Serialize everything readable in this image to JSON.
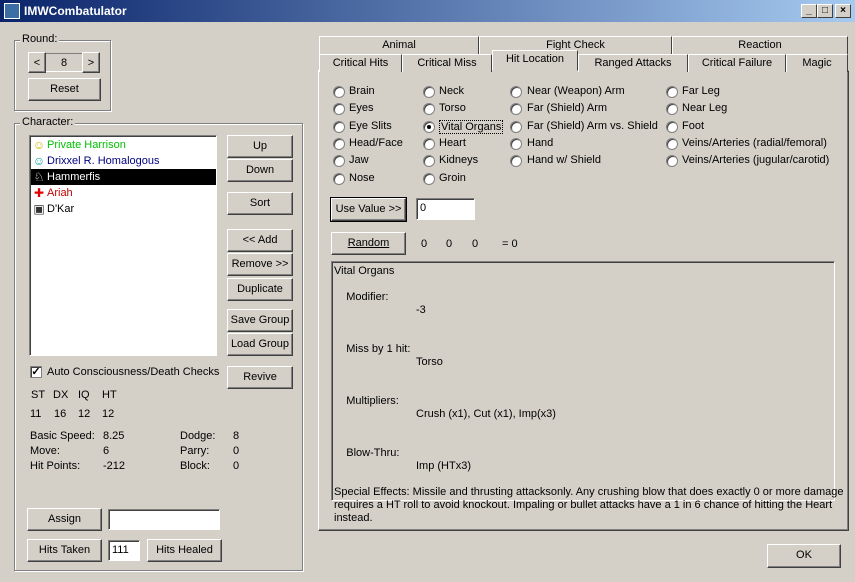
{
  "window": {
    "title": "IMWCombatulator",
    "controls": [
      "_",
      "□",
      "×"
    ]
  },
  "round": {
    "label": "Round:",
    "value": "8",
    "prev": "<",
    "next": ">",
    "reset": "Reset"
  },
  "character": {
    "label": "Character:",
    "items": [
      {
        "name": "Private Harrison",
        "color": "#00c000",
        "icon": "☺",
        "icon_name": "smiley-icon"
      },
      {
        "name": "Drixxel R. Homalogous",
        "color": "#000080",
        "icon": "☺",
        "icon_name": "smiley-cyan-icon"
      },
      {
        "name": "Hammerfis",
        "color": "#ffffff",
        "icon": "♘",
        "icon_name": "knight-icon",
        "selected": true
      },
      {
        "name": "Ariah",
        "color": "#c00000",
        "icon": "✚",
        "icon_name": "red-cross-icon"
      },
      {
        "name": "D'Kar",
        "color": "#000000",
        "icon": "▣",
        "icon_name": "rip-tombstone-icon"
      }
    ],
    "buttons": {
      "up": "Up",
      "down": "Down",
      "sort": "Sort",
      "add": "<< Add",
      "remove": "Remove >>",
      "duplicate": "Duplicate",
      "save_group": "Save Group",
      "load_group": "Load Group",
      "revive": "Revive"
    },
    "auto_checks": {
      "label": "Auto Consciousness/Death Checks",
      "checked": true
    },
    "stats": {
      "headers": [
        "ST",
        "DX",
        "IQ",
        "HT"
      ],
      "values": [
        "11",
        "16",
        "12",
        "12"
      ],
      "basic_speed_label": "Basic Speed:",
      "basic_speed": "8.25",
      "move_label": "Move:",
      "move": "6",
      "hit_points_label": "Hit Points:",
      "hit_points": "-212",
      "dodge_label": "Dodge:",
      "dodge": "8",
      "parry_label": "Parry:",
      "parry": "0",
      "block_label": "Block:",
      "block": "0"
    },
    "assign": "Assign",
    "assign_value": "",
    "hits_taken": "Hits Taken",
    "hits_value": "111",
    "hits_healed": "Hits Healed"
  },
  "tabs": {
    "row1": [
      "Animal",
      "Fight Check",
      "Reaction"
    ],
    "row2": [
      "Critical Hits",
      "Critical Miss",
      "Hit Location",
      "Ranged Attacks",
      "Critical Failure",
      "Magic"
    ],
    "active": "Hit Location"
  },
  "locations": {
    "col1": [
      "Brain",
      "Eyes",
      "Eye Slits",
      "Head/Face",
      "Jaw",
      "Nose"
    ],
    "col2": [
      "Neck",
      "Torso",
      "Vital Organs",
      "Heart",
      "Kidneys",
      "Groin"
    ],
    "col3": [
      "Near (Weapon) Arm",
      "Far (Shield) Arm",
      "Far (Shield) Arm vs. Shield",
      "Hand",
      "Hand w/ Shield"
    ],
    "col4": [
      "Far Leg",
      "Near Leg",
      "Foot",
      "Veins/Arteries (radial/femoral)",
      "Veins/Arteries (jugular/carotid)"
    ],
    "selected": "Vital Organs"
  },
  "use_value": {
    "label": "Use Value >>",
    "value": "0"
  },
  "random": {
    "label": "Random",
    "r1": "0",
    "r2": "0",
    "r3": "0",
    "result": "= 0"
  },
  "details": {
    "lines": [
      "Vital Organs",
      "Modifier:",
      "Miss by 1 hit:",
      "Multipliers:",
      "Blow-Thru:",
      "Special Effects: Missile and thrusting attacksonly. Any crushing blow that does exactly 0 or more damage",
      "requires a HT roll to avoid knockout. Impaling or bullet attacks have a 1 in 6 chance of hitting the Heart",
      "instead."
    ],
    "values": [
      "",
      "-3",
      "Torso",
      "Crush (x1), Cut (x1), Imp(x3)",
      "Imp (HTx3)"
    ]
  },
  "ok": "OK"
}
